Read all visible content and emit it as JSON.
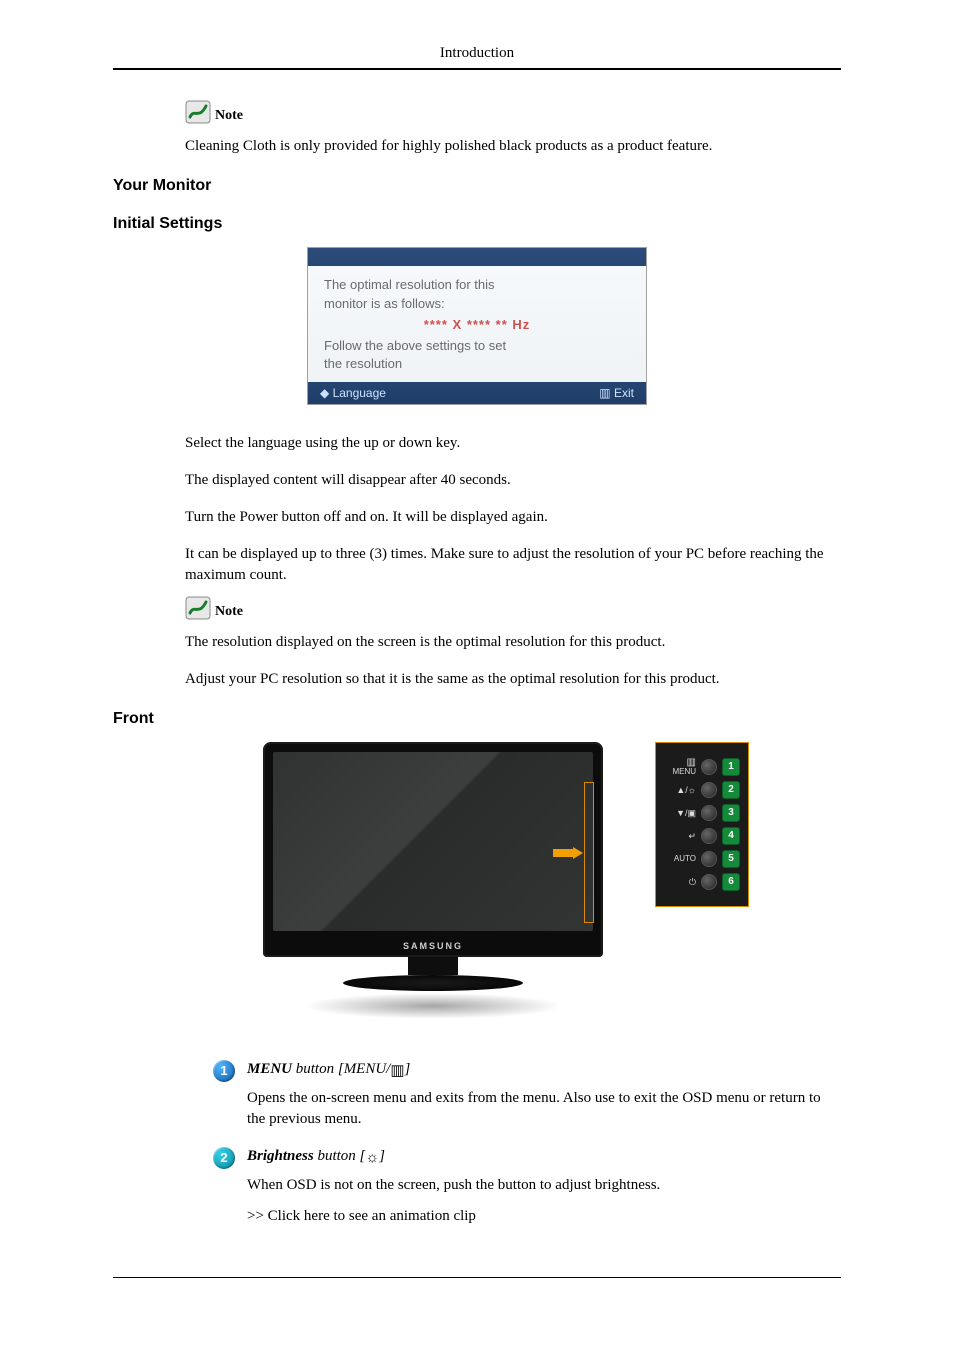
{
  "header": {
    "section": "Introduction"
  },
  "note1": {
    "label": "Note",
    "text": "Cleaning Cloth is only provided for highly polished black products as a product feature."
  },
  "headings": {
    "your_monitor": "Your Monitor",
    "initial_settings": "Initial Settings",
    "front": "Front"
  },
  "osd": {
    "line1": "The optimal resolution for this",
    "line2": "monitor is as follows:",
    "hz_line": "**** X **** ** Hz",
    "line3": "Follow the above settings to set",
    "line4": "the resolution",
    "footer_left": "◆ Language",
    "footer_right_icon": "▥",
    "footer_right": "Exit"
  },
  "initial_paras": {
    "p1": "Select the language using the up or down key.",
    "p2": "The displayed content will disappear after 40 seconds.",
    "p3": "Turn the Power button off and on. It will be displayed again.",
    "p4": "It can be displayed up to three (3) times. Make sure to adjust the resolution of your PC before reaching the maximum count."
  },
  "note2": {
    "label": "Note",
    "p1": "The resolution displayed on the screen is the optimal resolution for this product.",
    "p2": "Adjust your PC resolution so that it is the same as the optimal resolution for this product."
  },
  "monitor": {
    "logo": "SAMSUNG",
    "buttons": [
      {
        "num": "1",
        "label_top": "▥",
        "label_bot": "MENU"
      },
      {
        "num": "2",
        "label_top": "▲/☼",
        "label_bot": ""
      },
      {
        "num": "3",
        "label_top": "▼/▣",
        "label_bot": ""
      },
      {
        "num": "4",
        "label_top": "↵",
        "label_bot": ""
      },
      {
        "num": "5",
        "label_top": "AUTO",
        "label_bot": ""
      },
      {
        "num": "6",
        "label_top": "⏻",
        "label_bot": ""
      }
    ]
  },
  "front_list": {
    "item1": {
      "num": "1",
      "title_bold": "MENU",
      "title_rest_before": " button [MENU/",
      "title_glyph": "▥",
      "title_rest_after": "]",
      "desc": "Opens the on-screen menu and exits from the menu. Also use to exit the OSD menu or return to the previous menu."
    },
    "item2": {
      "num": "2",
      "title_bold": "Brightness",
      "title_rest_before": " button [",
      "title_glyph": "☼",
      "title_rest_after": "]",
      "desc": "When OSD is not on the screen, push the button to adjust brightness.",
      "link": ">> Click here to see an animation clip"
    }
  }
}
